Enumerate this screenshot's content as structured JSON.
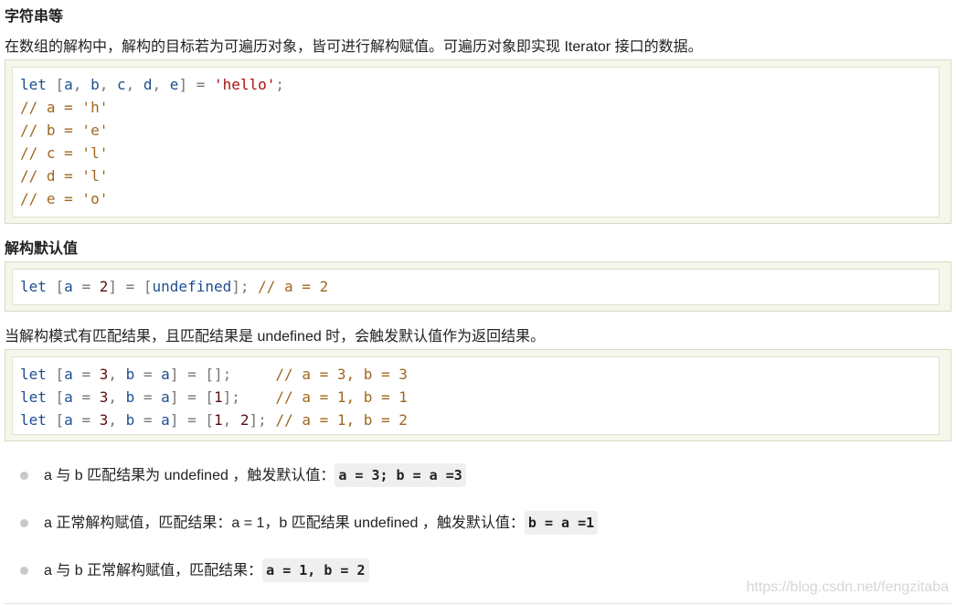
{
  "section1": {
    "heading": "字符串等",
    "description": "在数组的解构中，解构的目标若为可遍历对象，皆可进行解构赋值。可遍历对象即实现 Iterator 接口的数据。",
    "code": {
      "line1": {
        "kw": "let",
        "open": " [",
        "a": "a",
        ",1": ", ",
        "b": "b",
        ",2": ", ",
        "c": "c",
        ",3": ", ",
        "d": "d",
        ",4": ", ",
        "e": "e",
        "close": "] = ",
        "str": "'hello'",
        "end": ";"
      },
      "comments": [
        "// a = 'h'",
        "// b = 'e'",
        "// c = 'l'",
        "// d = 'l'",
        "// e = 'o'"
      ]
    }
  },
  "section2": {
    "heading": "解构默认值",
    "code": {
      "kw": "let",
      "p1": " [",
      "a": "a",
      "p2": " = ",
      "n": "2",
      "p3": "] = [",
      "u": "undefined",
      "p4": "]; ",
      "cm": "// a = 2"
    },
    "description": "当解构模式有匹配结果，且匹配结果是 undefined 时，会触发默认值作为返回结果。"
  },
  "section3": {
    "code": [
      {
        "kw": "let",
        "p1": " [",
        "a": "a",
        "p2": " = ",
        "n1": "3",
        "p3": ", ",
        "b": "b",
        "p4": " = ",
        "a2": "a",
        "p5": "] = [",
        "v1": "",
        "p6": "",
        "v2": "",
        "p7": "];     ",
        "cm": "// a = 3, b = 3"
      },
      {
        "kw": "let",
        "p1": " [",
        "a": "a",
        "p2": " = ",
        "n1": "3",
        "p3": ", ",
        "b": "b",
        "p4": " = ",
        "a2": "a",
        "p5": "] = [",
        "v1": "1",
        "p6": "",
        "v2": "",
        "p7": "];    ",
        "cm": "// a = 1, b = 1"
      },
      {
        "kw": "let",
        "p1": " [",
        "a": "a",
        "p2": " = ",
        "n1": "3",
        "p3": ", ",
        "b": "b",
        "p4": " = ",
        "a2": "a",
        "p5": "] = [",
        "v1": "1",
        "p6": ", ",
        "v2": "2",
        "p7": "]; ",
        "cm": "// a = 1, b = 2"
      }
    ]
  },
  "notes": [
    {
      "text": "a 与 b 匹配结果为 undefined ，触发默认值：",
      "code": "a = 3; b = a =3"
    },
    {
      "text": "a 正常解构赋值，匹配结果：a = 1，b 匹配结果 undefined ，触发默认值：",
      "code": "b = a =1"
    },
    {
      "text": "a 与 b 正常解构赋值，匹配结果：",
      "code": "a = 1, b = 2"
    }
  ],
  "watermark": "https://blog.csdn.net/fengzitaba"
}
